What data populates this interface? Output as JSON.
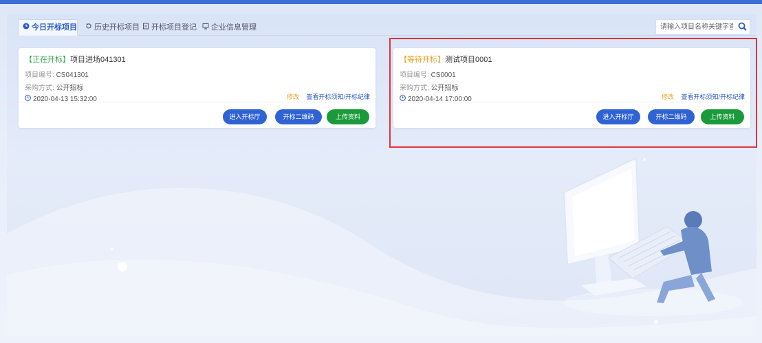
{
  "tabs": [
    {
      "label": "今日开标项目",
      "icon": "clock-icon",
      "active": true
    },
    {
      "label": "历史开标项目",
      "icon": "history-icon",
      "active": false
    },
    {
      "label": "开标项目登记",
      "icon": "document-icon",
      "active": false
    },
    {
      "label": "企业信息管理",
      "icon": "monitor-icon",
      "active": false
    }
  ],
  "search": {
    "placeholder": "请输入项目名称关键字查询",
    "icon": "search-icon"
  },
  "cards": [
    {
      "status": "【正在开标】",
      "status_color": "#34a853",
      "name": "项目进场041301",
      "code_label": "项目编号:",
      "code": "CS041301",
      "method_label": "采购方式:",
      "method": "公开招标",
      "time": "2020-04-13 15:32:00",
      "edit_link": "修改",
      "view_link": "查看开标须知/开标纪律",
      "buttons": {
        "enter": "进入开标厅",
        "qrcode": "开标二维码",
        "upload": "上传资料"
      }
    },
    {
      "status": "【等待开标】",
      "status_color": "#f0a020",
      "name": "测试项目0001",
      "code_label": "项目编号:",
      "code": "CS0001",
      "method_label": "采购方式:",
      "method": "公开招标",
      "time": "2020-04-14 17:00:00",
      "edit_link": "修改",
      "view_link": "查看开标须知/开标纪律",
      "buttons": {
        "enter": "进入开标厅",
        "qrcode": "开标二维码",
        "upload": "上传资料"
      }
    }
  ],
  "colors": {
    "accent": "#2f63d3",
    "upload": "#1a9a3a",
    "highlight": "#e0333a",
    "topbar": "#3d6fd6"
  }
}
